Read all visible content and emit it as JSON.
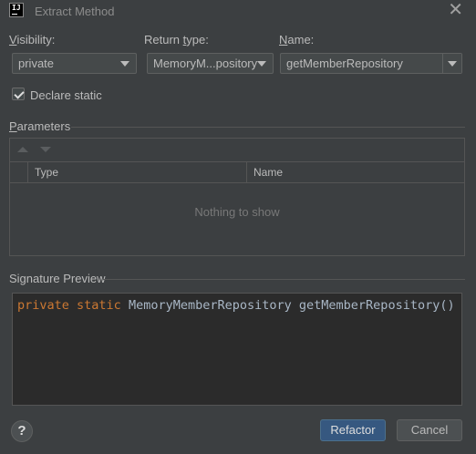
{
  "window": {
    "title": "Extract Method",
    "app_icon_text": "IJ"
  },
  "visibility": {
    "label_underlined": "V",
    "label_rest": "isibility:",
    "value": "private"
  },
  "return_type": {
    "label_prefix": "Return ",
    "label_underlined": "t",
    "label_rest": "ype:",
    "value": "MemoryM...pository"
  },
  "name": {
    "label_underlined": "N",
    "label_rest": "ame:",
    "value": "getMemberRepository"
  },
  "declare_static": {
    "label": "Declare static",
    "checked": true
  },
  "parameters": {
    "title_underlined": "P",
    "title_rest": "arameters",
    "columns": [
      "Type",
      "Name"
    ],
    "empty_text": "Nothing to show"
  },
  "signature": {
    "title": "Signature Preview",
    "kw1": "private",
    "kw2": "static",
    "rest": "MemoryMemberRepository getMemberRepository()"
  },
  "buttons": {
    "help": "?",
    "refactor": "Refactor",
    "cancel": "Cancel"
  },
  "colors": {
    "background": "#3c3f41",
    "editor_bg": "#2b2b2b",
    "keyword": "#cc7832",
    "code_text": "#a9b7c6",
    "primary_button": "#365880"
  }
}
